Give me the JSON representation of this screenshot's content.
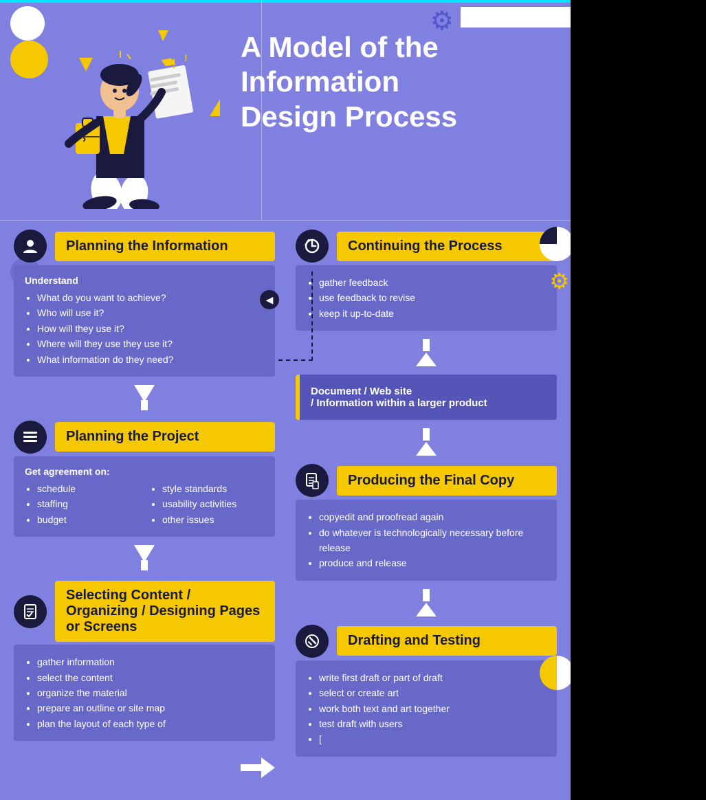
{
  "page": {
    "title": "A Model of the Information Design Process",
    "background_color": "#8080e0",
    "cyan_top_border": true
  },
  "header": {
    "title_line1": "A Model of the",
    "title_line2": "Information",
    "title_line3": "Design Process"
  },
  "left_column": {
    "sections": [
      {
        "id": "planning-info",
        "icon": "person-icon",
        "title": "Planning the Information",
        "content_label": "Understand",
        "items": [
          "What do you want to achieve?",
          "Who will use it?",
          "How will they use it?",
          "Where will they use they use it?",
          "What information do they need?"
        ]
      },
      {
        "id": "planning-project",
        "icon": "list-icon",
        "title": "Planning the Project",
        "content_label": "Get agreement on:",
        "col1_items": [
          "schedule",
          "staffing",
          "budget"
        ],
        "col2_items": [
          "style standards",
          "usability activities",
          "other issues"
        ]
      },
      {
        "id": "selecting-content",
        "icon": "document-check-icon",
        "title": "Selecting Content / Organizing / Designing Pages or Screens",
        "content_items": [
          "gather information",
          "select the content",
          "organize the material",
          "prepare an outline or site map",
          "plan the layout of each type of"
        ]
      }
    ]
  },
  "right_column": {
    "sections": [
      {
        "id": "continuing-process",
        "icon": "refresh-icon",
        "title": "Continuing the Process",
        "items": [
          "gather feedback",
          "use feedback to revise",
          "keep it up-to-date"
        ]
      },
      {
        "id": "document-box",
        "line1": "Document  /  Web site",
        "line2": "/  Information within a larger product"
      },
      {
        "id": "producing-final",
        "icon": "document-icon",
        "title": "Producing the Final Copy",
        "items": [
          "copyedit and proofread again",
          "do whatever is technologically necessary before release",
          "produce and release"
        ]
      },
      {
        "id": "drafting-testing",
        "icon": "pencil-icon",
        "title": "Drafting and Testing",
        "items": [
          "write first draft or part of draft",
          "select or create art",
          "work both text and art together",
          "test draft with users",
          "["
        ]
      }
    ]
  },
  "icons": {
    "person": "👤",
    "list": "☰",
    "doc_check": "📋",
    "refresh": "↻",
    "document": "📄",
    "pencil": "✏",
    "arrow_down": "↓",
    "arrow_up": "↑",
    "arrow_right": "→",
    "triangle_left": "◀",
    "triangle_up": "▲"
  }
}
